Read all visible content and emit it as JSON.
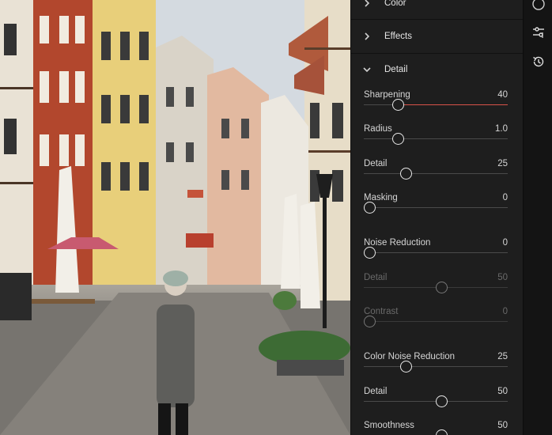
{
  "panel": {
    "sections": [
      {
        "label": "Color",
        "expanded": false
      },
      {
        "label": "Effects",
        "expanded": false
      },
      {
        "label": "Detail",
        "expanded": true
      }
    ],
    "sliders": [
      {
        "label": "Sharpening",
        "value": "40",
        "fraction": 0.2,
        "fill": true,
        "enabled": true
      },
      {
        "label": "Radius",
        "value": "1.0",
        "fraction": 0.2,
        "fill": false,
        "enabled": true
      },
      {
        "label": "Detail",
        "value": "25",
        "fraction": 0.25,
        "fill": false,
        "enabled": true
      },
      {
        "label": "Masking",
        "value": "0",
        "fraction": 0.0,
        "fill": false,
        "enabled": true
      },
      {
        "label": "Noise Reduction",
        "value": "0",
        "fraction": 0.0,
        "fill": false,
        "enabled": true
      },
      {
        "label": "Detail",
        "value": "50",
        "fraction": 0.5,
        "fill": false,
        "enabled": false
      },
      {
        "label": "Contrast",
        "value": "0",
        "fraction": 0.0,
        "fill": false,
        "enabled": false
      },
      {
        "label": "Color Noise Reduction",
        "value": "25",
        "fraction": 0.25,
        "fill": false,
        "enabled": true
      },
      {
        "label": "Detail",
        "value": "50",
        "fraction": 0.5,
        "fill": false,
        "enabled": true
      },
      {
        "label": "Smoothness",
        "value": "50",
        "fraction": 0.5,
        "fill": false,
        "enabled": true
      }
    ],
    "accent_color": "#d8534a"
  },
  "rail": {
    "icons": [
      "circle-icon",
      "adjust-sliders-icon",
      "history-icon"
    ]
  }
}
